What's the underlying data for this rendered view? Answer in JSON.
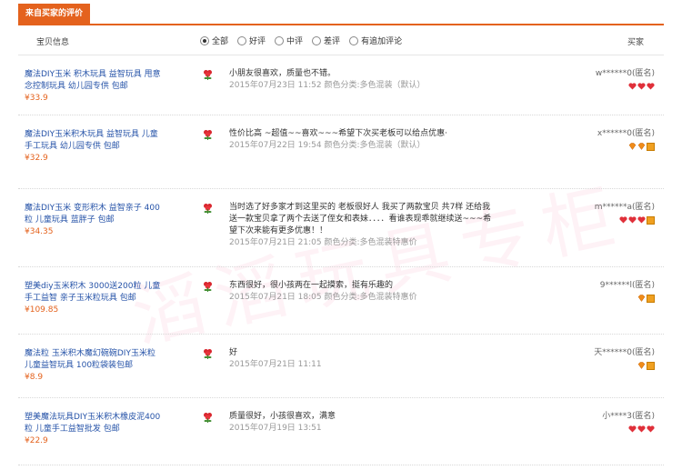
{
  "tab": {
    "label": "来自买家的评价"
  },
  "header": {
    "item_label": "宝贝信息",
    "buyer_label": "买家",
    "filters": [
      {
        "label": "全部",
        "selected": true
      },
      {
        "label": "好评",
        "selected": false
      },
      {
        "label": "中评",
        "selected": false
      },
      {
        "label": "差评",
        "selected": false
      },
      {
        "label": "有追加评论",
        "selected": false
      }
    ]
  },
  "reviews": [
    {
      "product": "魔法DIY玉米 积木玩具 益智玩具 甩意念控制玩具 幼儿园专供 包邮",
      "price": "¥33.9",
      "text": "小朋友很喜欢，质量也不错。",
      "meta": "2015年07月23日 11:52 颜色分类:多色混装（默认）",
      "buyer": "w******0(匿名)",
      "rank_icons": [
        "heart",
        "heart",
        "heart"
      ]
    },
    {
      "product": "魔法DIY玉米积木玩具 益智玩具 儿童手工玩具 幼儿园专供 包邮",
      "price": "¥32.9",
      "text": "性价比高 ~超值~~喜欢~~~希望下次买老板可以给点优惠·",
      "meta": "2015年07月22日 19:54 颜色分类:多色混装（默认）",
      "buyer": "x******0(匿名)",
      "rank_icons": [
        "gem",
        "gem",
        "badge"
      ]
    },
    {
      "product": "魔法DIY玉米 变形积木 益智亲子 400粒 儿童玩具 蓝胖子 包邮",
      "price": "¥34.35",
      "text": "当时选了好多家才到这里买的 老板很好人 我买了两款宝贝 共7样 还给我送一款宝贝拿了两个去送了侄女和表妹．．．．看谁表现乖就继续送~~~希望下次来能有更多优惠！！",
      "meta": "2015年07月21日 21:05 颜色分类:多色混装特惠价",
      "buyer": "m******a(匿名)",
      "rank_icons": [
        "heart",
        "heart",
        "heart",
        "badge"
      ]
    },
    {
      "product": "塑美diy玉米积木 3000送200粒 儿童手工益智 亲子玉米粒玩具 包邮",
      "price": "¥109.85",
      "text": "东西很好，很小孩两在一起摸索，挺有乐趣的",
      "meta": "2015年07月21日 18:05 颜色分类:多色混装特惠价",
      "buyer": "9******l(匿名)",
      "rank_icons": [
        "gem",
        "badge"
      ]
    },
    {
      "product": "魔法粒 玉米积木魔幻碗碗DIY玉米粒儿童益智玩具 100粒袋装包邮",
      "price": "¥8.9",
      "text": "好",
      "meta": "2015年07月21日 11:11",
      "buyer": "天******0(匿名)",
      "rank_icons": [
        "gem",
        "badge"
      ]
    },
    {
      "product": "塑美魔法玩具DIY玉米积木橡皮泥400粒 儿童手工益智批发 包邮",
      "price": "¥22.9",
      "text": "质量很好，小孩很喜欢，满意",
      "meta": "2015年07月19日 13:51",
      "buyer": "小****3(匿名)",
      "rank_icons": [
        "heart",
        "heart",
        "heart"
      ]
    }
  ],
  "watermark": "滔滔玩具专柜",
  "colors": {
    "accent": "#e4621d",
    "link": "#2653a8",
    "price": "#e4621d",
    "heart": "#e0303a",
    "gem": "#f08c1a"
  }
}
